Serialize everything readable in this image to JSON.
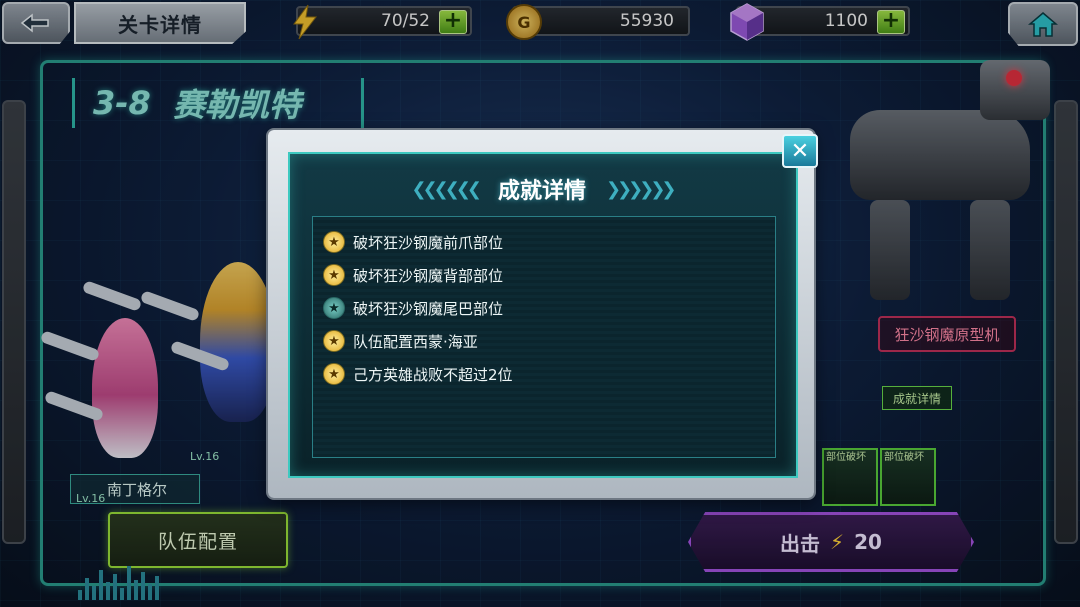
{
  "topbar": {
    "title": "关卡详情",
    "energy": "70/52",
    "gold": "55930",
    "gems": "1100",
    "plus": "+",
    "gold_icon_letter": "G"
  },
  "stage": {
    "number": "3-8",
    "name": "赛勒凯特"
  },
  "heroes": {
    "hero1_name": "南丁格尔",
    "hero1_level": "Lv.16",
    "hero2_level": "Lv.16"
  },
  "buttons": {
    "team": "队伍配置",
    "attack": "出击",
    "attack_cost": "20",
    "achievement_details": "成就详情"
  },
  "boss": {
    "name": "狂沙钢魔原型机"
  },
  "cards": [
    {
      "caption": "部位破坏"
    },
    {
      "caption": "部位破坏"
    }
  ],
  "modal": {
    "title": "成就详情",
    "close": "✕",
    "items": [
      {
        "text": "破坏狂沙钢魔前爪部位",
        "achieved": true
      },
      {
        "text": "破坏狂沙钢魔背部部位",
        "achieved": true
      },
      {
        "text": "破坏狂沙钢魔尾巴部位",
        "achieved": false
      },
      {
        "text": "队伍配置西蒙·海亚",
        "achieved": true
      },
      {
        "text": "己方英雄战败不超过2位",
        "achieved": true
      }
    ]
  },
  "icons": {
    "back": "back-arrow-icon",
    "home": "home-icon",
    "energy": "lightning-icon",
    "gold": "gold-coin-icon",
    "gem": "gem-icon",
    "star": "star-icon"
  },
  "colors": {
    "accent_teal": "#3dc9c0",
    "attack_purple": "#a453e0",
    "team_green": "#9adf3a",
    "boss_red": "#c0305a",
    "star_gold": "#e0a820"
  }
}
